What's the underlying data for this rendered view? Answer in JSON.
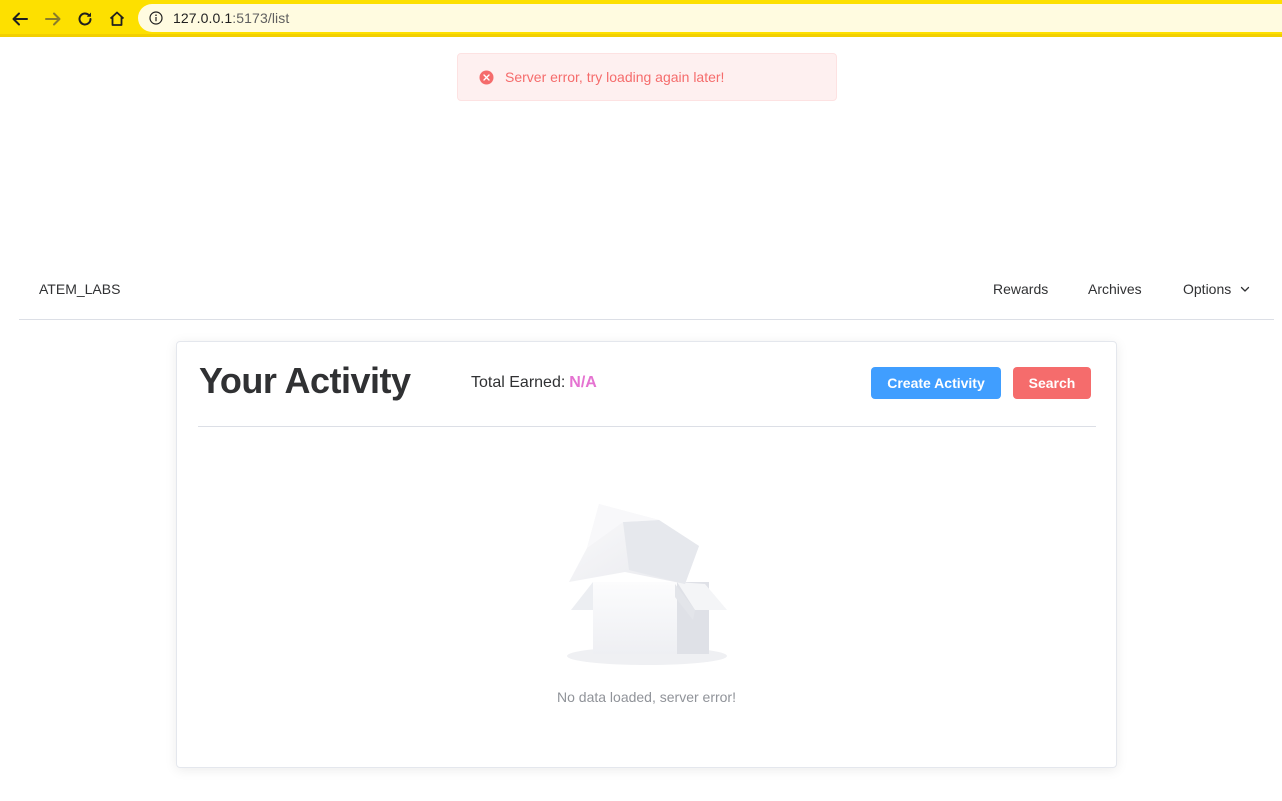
{
  "browser": {
    "url_host": "127.0.0.1",
    "url_path": ":5173/list"
  },
  "toast": {
    "message": "Server error, try loading again later!"
  },
  "navbar": {
    "brand": "ATEM_LABS",
    "items": [
      {
        "label": "Rewards"
      },
      {
        "label": "Archives"
      },
      {
        "label": "Options"
      }
    ]
  },
  "card": {
    "title": "Your Activity",
    "earned_label": "Total Earned:",
    "earned_value": "N/A",
    "create_label": "Create Activity",
    "search_label": "Search",
    "empty_text": "No data loaded, server error!"
  },
  "colors": {
    "browser_bar": "#fde000",
    "primary": "#409eff",
    "danger": "#f56c6c",
    "earned_value": "#e573d1"
  },
  "icons": [
    "back-arrow-icon",
    "forward-arrow-icon",
    "reload-icon",
    "home-icon",
    "info-icon",
    "error-circle-icon",
    "chevron-down-icon",
    "empty-box-icon"
  ]
}
